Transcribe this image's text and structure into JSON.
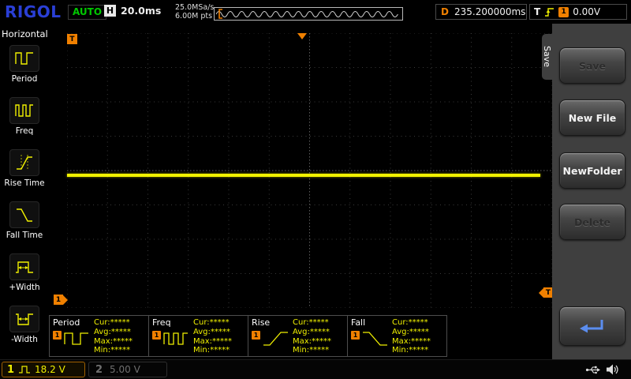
{
  "topbar": {
    "logo": "RIGOL",
    "run_status": "AUTO",
    "horizontal_label": "H",
    "timebase": "20.0ms",
    "sample_rate": "25.0MSa/s",
    "memory_depth": "6.00M pts",
    "delay_label": "D",
    "delay_value": "235.200000ms",
    "trigger_label": "T",
    "trigger_source": "1",
    "trigger_level": "0.00V"
  },
  "sidebar": {
    "title": "Horizontal",
    "items": [
      {
        "label": "Period",
        "icon": "period-icon"
      },
      {
        "label": "Freq",
        "icon": "freq-icon"
      },
      {
        "label": "Rise Time",
        "icon": "rise-time-icon"
      },
      {
        "label": "Fall Time",
        "icon": "fall-time-icon"
      },
      {
        "label": "+Width",
        "icon": "plus-width-icon"
      },
      {
        "label": "-Width",
        "icon": "minus-width-icon"
      }
    ]
  },
  "menu": {
    "tab": "Save",
    "buttons": [
      {
        "label": "Save",
        "enabled": false
      },
      {
        "label": "New File",
        "enabled": true
      },
      {
        "label": "NewFolder",
        "enabled": true
      },
      {
        "label": "Delete",
        "enabled": false
      },
      {
        "label": "",
        "enabled": true,
        "icon": "return-arrow-icon"
      }
    ]
  },
  "display": {
    "trigger_corner": "T",
    "channel_marker": "1",
    "trigger_level_marker": "T",
    "trace": {
      "channel": "1",
      "color": "#f2f200",
      "description": "flat horizontal line near vertical center, spanning full width"
    }
  },
  "measurements": {
    "row_labels": [
      "Cur:",
      "Avg:",
      "Max:",
      "Min:"
    ],
    "panels": [
      {
        "name": "Period",
        "channel": "1",
        "values": [
          "*****",
          "*****",
          "*****",
          "*****"
        ]
      },
      {
        "name": "Freq",
        "channel": "1",
        "values": [
          "*****",
          "*****",
          "*****",
          "*****"
        ]
      },
      {
        "name": "Rise",
        "channel": "1",
        "values": [
          "*****",
          "*****",
          "*****",
          "*****"
        ]
      },
      {
        "name": "Fall",
        "channel": "1",
        "values": [
          "*****",
          "*****",
          "*****",
          "*****"
        ]
      }
    ]
  },
  "statusbar": {
    "ch1": {
      "number": "1",
      "scale": "18.2 V"
    },
    "ch2": {
      "number": "2",
      "scale": "5.00 V"
    }
  },
  "colors": {
    "channel1_yellow": "#f2f200",
    "trigger_orange": "#f08000",
    "auto_green": "#00c800",
    "logo_blue": "#2a3fd6",
    "menu_gray": "#3f3f3f"
  }
}
